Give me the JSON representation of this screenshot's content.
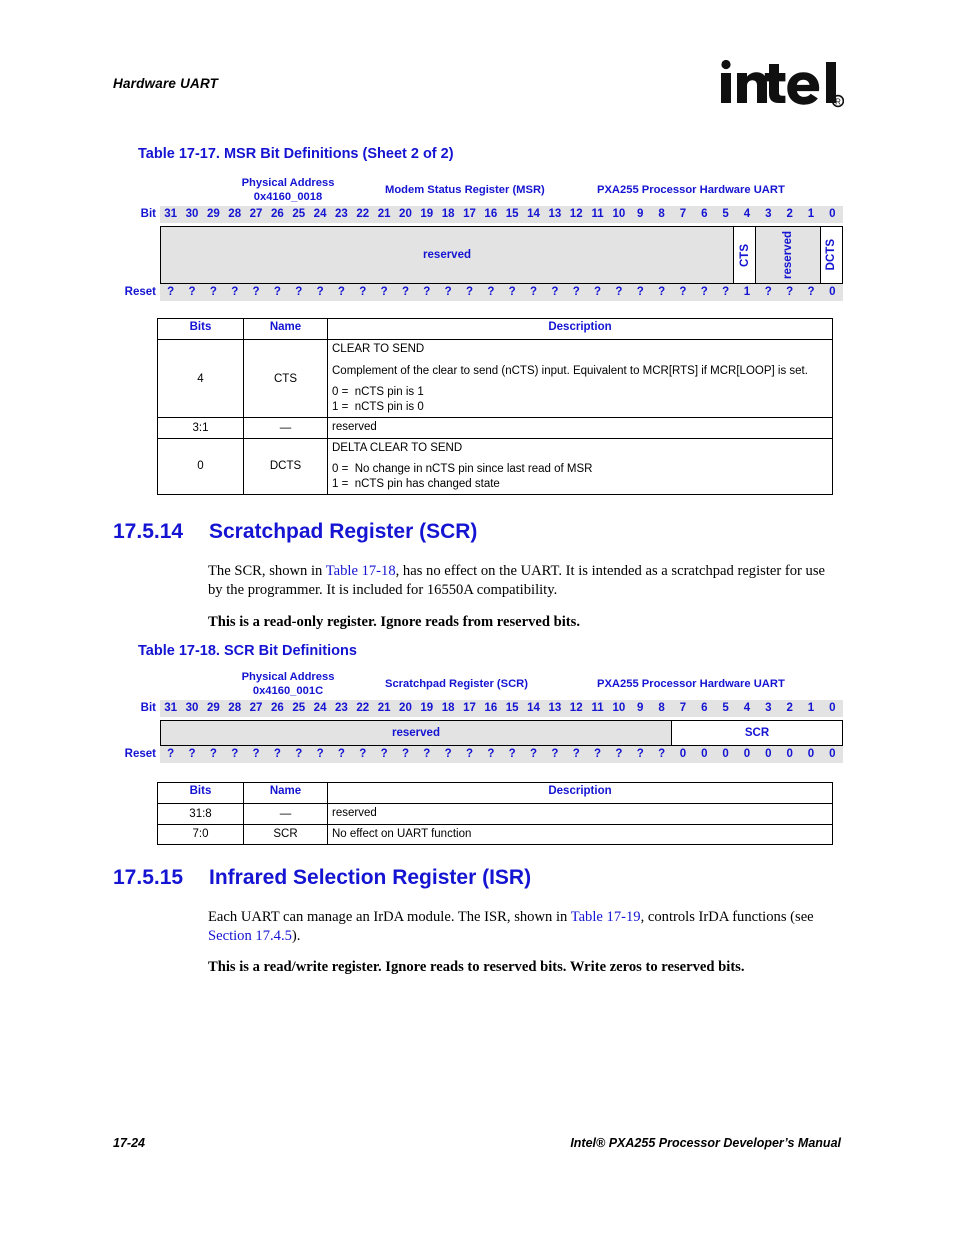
{
  "header": {
    "running_head": "Hardware UART",
    "logo_alt": "intel-logo",
    "logo_text": "intel",
    "logo_registered": "®"
  },
  "footer": {
    "page_number": "17-24",
    "manual_title": "Intel® PXA255 Processor Developer’s Manual"
  },
  "table_msr": {
    "caption": "Table 17-17. MSR Bit Definitions (Sheet 2 of 2)",
    "diagram": {
      "address_label": "Physical Address",
      "address_value": "0x4160_0018",
      "register_name": "Modem Status Register (MSR)",
      "peripheral": "PXA255 Processor Hardware UART",
      "bit_row_label": "Bit",
      "reset_row_label": "Reset",
      "bit_numbers": [
        "31",
        "30",
        "29",
        "28",
        "27",
        "26",
        "25",
        "24",
        "23",
        "22",
        "21",
        "20",
        "19",
        "18",
        "17",
        "16",
        "15",
        "14",
        "13",
        "12",
        "11",
        "10",
        "9",
        "8",
        "7",
        "6",
        "5",
        "4",
        "3",
        "2",
        "1",
        "0"
      ],
      "fields": [
        {
          "label": "reserved",
          "span": 27,
          "orientation": "horizontal",
          "fill": "gray"
        },
        {
          "label": "CTS",
          "span": 1,
          "orientation": "vertical",
          "fill": "white"
        },
        {
          "label": "reserved",
          "span": 3,
          "orientation": "vertical",
          "fill": "gray"
        },
        {
          "label": "DCTS",
          "span": 1,
          "orientation": "vertical",
          "fill": "white"
        }
      ],
      "reset_values": [
        "?",
        "?",
        "?",
        "?",
        "?",
        "?",
        "?",
        "?",
        "?",
        "?",
        "?",
        "?",
        "?",
        "?",
        "?",
        "?",
        "?",
        "?",
        "?",
        "?",
        "?",
        "?",
        "?",
        "?",
        "?",
        "?",
        "?",
        "1",
        "?",
        "?",
        "?",
        "0"
      ]
    },
    "columns": [
      "Bits",
      "Name",
      "Description"
    ],
    "rows": [
      {
        "bits": "4",
        "name": "CTS",
        "desc_title": "CLEAR TO SEND",
        "desc_body": "Complement of the clear to send (nCTS) input. Equivalent to MCR[RTS] if MCR[LOOP] is set.",
        "values": [
          "0 =  nCTS pin is 1",
          "1 =  nCTS pin is 0"
        ]
      },
      {
        "bits": "3:1",
        "name": "—",
        "desc_title": "reserved",
        "desc_body": "",
        "values": []
      },
      {
        "bits": "0",
        "name": "DCTS",
        "desc_title": "DELTA CLEAR TO SEND",
        "desc_body": "",
        "values": [
          "0 =  No change in nCTS pin since last read of MSR",
          "1 =  nCTS pin has changed state"
        ]
      }
    ]
  },
  "section_scr": {
    "number": "17.5.14",
    "title": "Scratchpad Register (SCR)",
    "para1_pre": "The SCR, shown in ",
    "para1_xref": "Table 17-18",
    "para1_post": ", has no effect on the UART. It is intended as a scratchpad register for use by the programmer. It is included for 16550A compatibility.",
    "para2": "This is a read-only register. Ignore reads from reserved bits."
  },
  "table_scr": {
    "caption": "Table 17-18. SCR Bit Definitions",
    "diagram": {
      "address_label": "Physical Address",
      "address_value": "0x4160_001C",
      "register_name": "Scratchpad Register (SCR)",
      "peripheral": "PXA255 Processor Hardware UART",
      "bit_row_label": "Bit",
      "reset_row_label": "Reset",
      "bit_numbers": [
        "31",
        "30",
        "29",
        "28",
        "27",
        "26",
        "25",
        "24",
        "23",
        "22",
        "21",
        "20",
        "19",
        "18",
        "17",
        "16",
        "15",
        "14",
        "13",
        "12",
        "11",
        "10",
        "9",
        "8",
        "7",
        "6",
        "5",
        "4",
        "3",
        "2",
        "1",
        "0"
      ],
      "fields": [
        {
          "label": "reserved",
          "span": 24,
          "orientation": "horizontal",
          "fill": "gray"
        },
        {
          "label": "SCR",
          "span": 8,
          "orientation": "horizontal",
          "fill": "white"
        }
      ],
      "reset_values": [
        "?",
        "?",
        "?",
        "?",
        "?",
        "?",
        "?",
        "?",
        "?",
        "?",
        "?",
        "?",
        "?",
        "?",
        "?",
        "?",
        "?",
        "?",
        "?",
        "?",
        "?",
        "?",
        "?",
        "?",
        "0",
        "0",
        "0",
        "0",
        "0",
        "0",
        "0",
        "0"
      ]
    },
    "columns": [
      "Bits",
      "Name",
      "Description"
    ],
    "rows": [
      {
        "bits": "31:8",
        "name": "—",
        "desc_title": "reserved",
        "desc_body": "",
        "values": []
      },
      {
        "bits": "7:0",
        "name": "SCR",
        "desc_title": "No effect on UART function",
        "desc_body": "",
        "values": []
      }
    ]
  },
  "section_isr": {
    "number": "17.5.15",
    "title": "Infrared Selection Register (ISR)",
    "para1_pre": "Each UART can manage an IrDA module. The ISR, shown in ",
    "para1_xref": "Table 17-19",
    "para1_mid": ", controls IrDA functions (see ",
    "para1_xref2": "Section 17.4.5",
    "para1_post": ").",
    "para2": "This is a read/write register. Ignore reads to reserved bits. Write zeros to reserved bits."
  },
  "colors": {
    "link_blue": "#1414d2",
    "field_gray": "#e3e3e3",
    "field_white": "#ffffff"
  }
}
